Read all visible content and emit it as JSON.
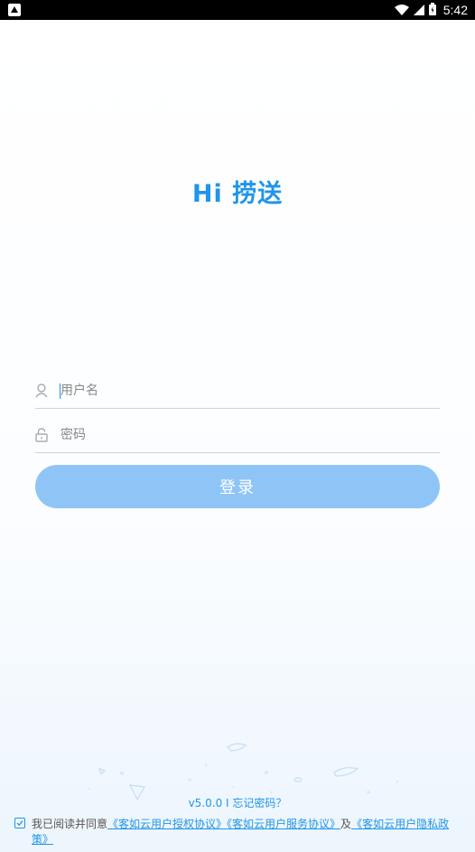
{
  "status_bar": {
    "time": "5:42",
    "icons": [
      "notification-icon",
      "wifi-icon",
      "signal-icon",
      "battery-icon"
    ]
  },
  "app": {
    "greeting": "Hi 捞送"
  },
  "login_form": {
    "username_placeholder": "用户名",
    "username_value": "",
    "password_placeholder": "密码",
    "password_value": "",
    "login_button_label": "登录"
  },
  "footer": {
    "version": "v5.0.0",
    "separator": "I",
    "forgot_password": "忘记密码？"
  },
  "agreement": {
    "checked": true,
    "prefix": "我已阅读并同意",
    "link_auth": "《客如云用户授权协议》",
    "link_service": "《客如云用户服务协议》",
    "joiner": "及",
    "link_privacy": "《客如云用户隐私政策》"
  },
  "colors": {
    "accent": "#1f95e8",
    "button_disabled": "#8ec5f6",
    "divider": "#cfd3d8",
    "status_bar": "#000000"
  }
}
